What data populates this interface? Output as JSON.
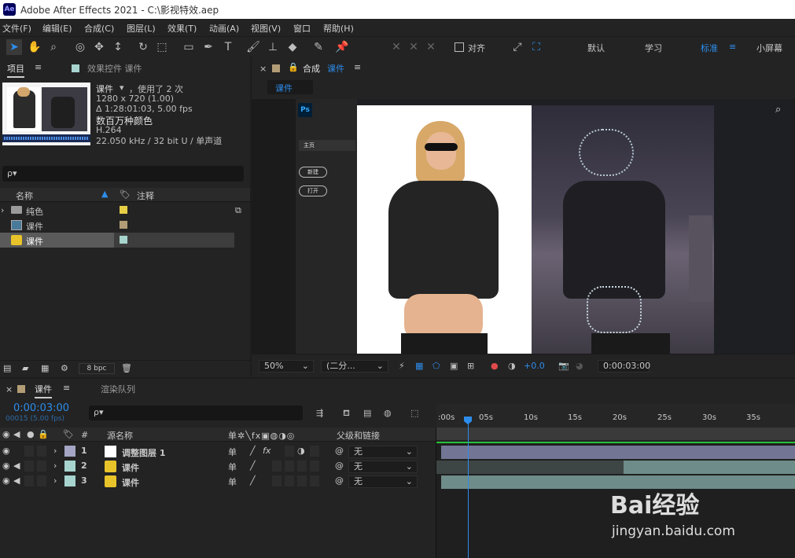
{
  "window": {
    "title": "Adobe After Effects 2021 - C:\\影视特效.aep",
    "logo": "Ae"
  },
  "menu": [
    "文件(F)",
    "编辑(E)",
    "合成(C)",
    "图层(L)",
    "效果(T)",
    "动画(A)",
    "视图(V)",
    "窗口",
    "帮助(H)"
  ],
  "toolbar": {
    "align_label": "对齐",
    "workspaces": [
      "默认",
      "学习",
      "标准",
      "小屏幕"
    ],
    "active_workspace": "标准"
  },
  "project": {
    "tab_project": "项目",
    "tab_effects": "效果控件 课件",
    "item_name": "课件",
    "usage": "，使用了 2 次",
    "resolution": "1280 x 720 (1.00)",
    "duration": "Δ 1:28:01:03, 5.00 fps",
    "color": "数百万种颜色",
    "codec": "H.264",
    "audio": "22.050 kHz / 32 bit U / 单声道",
    "search_placeholder": "ρ▾",
    "col_name": "名称",
    "col_comment": "注释",
    "rows": [
      {
        "name": "纯色",
        "label_color": "#e6cf45"
      },
      {
        "name": "课件",
        "label_color": "#b39d77"
      },
      {
        "name": "课件",
        "label_color": "#a7d4cf"
      }
    ],
    "bpc": "8 bpc"
  },
  "comp": {
    "tab_prefix": "合成",
    "tab_name": "课件",
    "sub_tab": "课件",
    "zoom": "50%",
    "resolution": "(二分...",
    "exposure": "+0.0",
    "timecode": "0:00:03:00",
    "ps_label": "Ps",
    "sidebar": {
      "home": "主页",
      "new_btn": "新建",
      "open_btn": "打开"
    }
  },
  "timeline": {
    "tab": "课件",
    "tab_render": "渲染队列",
    "timecode": "0:00:03:00",
    "frame_info": "00015 (5.00 fps)",
    "col_num": "#",
    "col_source": "源名称",
    "col_parent": "父级和链接",
    "ruler": [
      ":00s",
      "05s",
      "10s",
      "15s",
      "20s",
      "25s",
      "30s",
      "35s"
    ],
    "layers": [
      {
        "num": "1",
        "name": "调整图层 1",
        "label_color": "#a5a5c6",
        "parent": "无",
        "fx": "fx"
      },
      {
        "num": "2",
        "name": "课件",
        "label_color": "#a7d4cf",
        "parent": "无",
        "fx": ""
      },
      {
        "num": "3",
        "name": "课件",
        "label_color": "#a7d4cf",
        "parent": "无",
        "fx": ""
      }
    ]
  },
  "watermark": {
    "brand": "Bai经验",
    "url": "jingyan.baidu.com"
  },
  "colors": {
    "accent": "#2d8ceb",
    "panel": "#232323",
    "playhead": "#2d8ceb"
  }
}
